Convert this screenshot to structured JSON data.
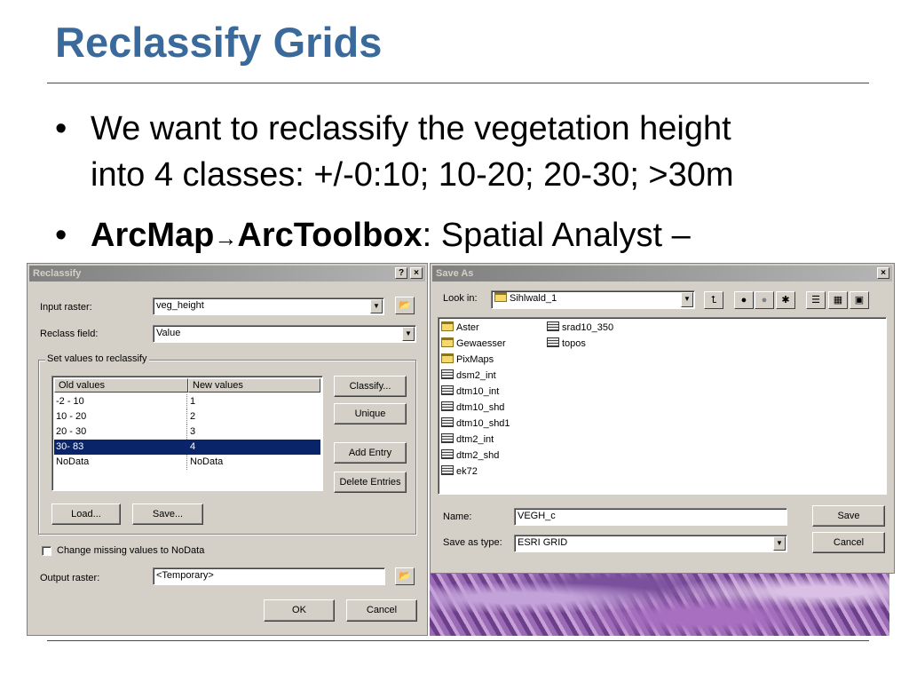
{
  "slide": {
    "title": "Reclassify Grids",
    "bullet1_line1": "We want to reclassify the vegetation height",
    "bullet1_line2": "into 4 classes: +/-0:10; 10-20; 20-30; >30m",
    "bullet2_bold1": "ArcMap",
    "bullet2_arrow": "→",
    "bullet2_bold2": "ArcToolbox",
    "bullet2_rest": ": Spatial Analyst –",
    "bullet_symbol": "•"
  },
  "reclassify": {
    "title": "Reclassify",
    "help_label": "?",
    "close_label": "×",
    "input_raster_label": "Input raster:",
    "input_raster_value": "veg_height",
    "reclass_field_label": "Reclass field:",
    "reclass_field_value": "Value",
    "group_title": "Set values to reclassify",
    "col_old": "Old values",
    "col_new": "New values",
    "rows": [
      {
        "old": "-2 - 10",
        "new": "1"
      },
      {
        "old": "10 - 20",
        "new": "2"
      },
      {
        "old": "20 - 30",
        "new": "3"
      },
      {
        "old": "30- 83",
        "new": "4"
      },
      {
        "old": "NoData",
        "new": "NoData"
      }
    ],
    "selected_row": 3,
    "classify_label": "Classify...",
    "unique_label": "Unique",
    "add_entry_label": "Add Entry",
    "delete_entries_label": "Delete Entries",
    "load_label": "Load...",
    "save_label": "Save...",
    "missing_nodata_label": "Change missing values to NoData",
    "missing_nodata_checked": false,
    "output_raster_label": "Output raster:",
    "output_raster_value": "<Temporary>",
    "ok_label": "OK",
    "cancel_label": "Cancel"
  },
  "save_as": {
    "title": "Save As",
    "close_label": "×",
    "look_in_label": "Look in:",
    "look_in_value": "Sihlwald_1",
    "files_col1": [
      {
        "name": "Aster",
        "icon": "folder-icon"
      },
      {
        "name": "Gewaesser",
        "icon": "folder-icon"
      },
      {
        "name": "PixMaps",
        "icon": "folder-icon"
      },
      {
        "name": "dsm2_int",
        "icon": "grid-icon"
      },
      {
        "name": "dtm10_int",
        "icon": "grid-icon"
      },
      {
        "name": "dtm10_shd",
        "icon": "grid-icon"
      },
      {
        "name": "dtm10_shd1",
        "icon": "grid-icon"
      },
      {
        "name": "dtm2_int",
        "icon": "grid-icon"
      },
      {
        "name": "dtm2_shd",
        "icon": "grid-icon"
      },
      {
        "name": "ek72",
        "icon": "grid-icon"
      }
    ],
    "files_col2": [
      {
        "name": "srad10_350",
        "icon": "grid-icon"
      },
      {
        "name": "topos",
        "icon": "grid-icon"
      }
    ],
    "name_label": "Name:",
    "name_value": "VEGH_c",
    "type_label": "Save as type:",
    "type_value": "ESRI GRID",
    "save_label": "Save",
    "cancel_label": "Cancel"
  },
  "colors": {
    "title_blue": "#3a6a9b",
    "dialog_face": "#d4d0c8",
    "selection": "#0a246a"
  }
}
